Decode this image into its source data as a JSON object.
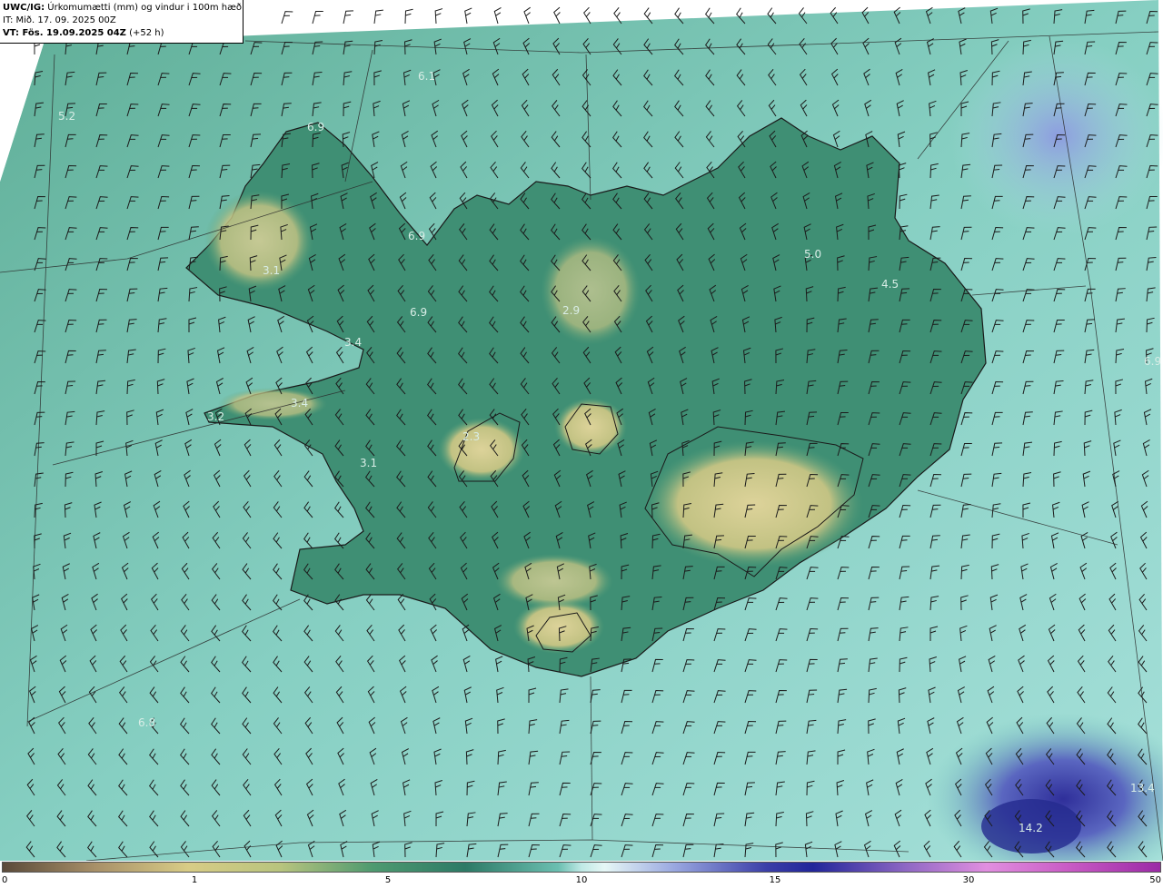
{
  "header": {
    "model": "UWC/IG:",
    "title": "Úrkomumætti (mm) og vindur i 100m hæð",
    "init_time": "IT: Mið. 17. 09. 2025 00Z",
    "valid_prefix": "VT: Fös. 19.09.2025 04Z",
    "valid_suffix": "(+52 h)"
  },
  "legend": {
    "ticks": [
      "0",
      "1",
      "5",
      "10",
      "15",
      "30",
      "50"
    ]
  },
  "value_labels": [
    {
      "text": "5.2",
      "id": "nw"
    },
    {
      "text": "6.1",
      "id": "north-sea"
    },
    {
      "text": "6.9",
      "id": "hornstrandir"
    },
    {
      "text": "6.9",
      "id": "westfjords-east"
    },
    {
      "text": "6.9",
      "id": "hunafloi"
    },
    {
      "text": "3.1",
      "id": "westfjords"
    },
    {
      "text": "3.4",
      "id": "breidafjordur"
    },
    {
      "text": "3.4",
      "id": "snaefellsnes"
    },
    {
      "text": "3.2",
      "id": "snaefellsnes-tip"
    },
    {
      "text": "3.1",
      "id": "borgarfjordur"
    },
    {
      "text": "2.9",
      "id": "north-highlands"
    },
    {
      "text": "2.3",
      "id": "langjokull"
    },
    {
      "text": "5.0",
      "id": "northeast"
    },
    {
      "text": "4.5",
      "id": "east"
    },
    {
      "text": "6.9",
      "id": "east-sea"
    },
    {
      "text": "6.8",
      "id": "southwest-sea"
    },
    {
      "text": "13.4",
      "id": "southeast-sea"
    },
    {
      "text": "14.2",
      "id": "southeast-low"
    }
  ],
  "colors": {
    "sea": "#7cc9bd",
    "lowland": "#3f8f74",
    "highland": "#cfc787",
    "heavy_precip": "#3b3ea8",
    "coastline": "#1a1a1a",
    "barb": "#1b1b1b"
  }
}
